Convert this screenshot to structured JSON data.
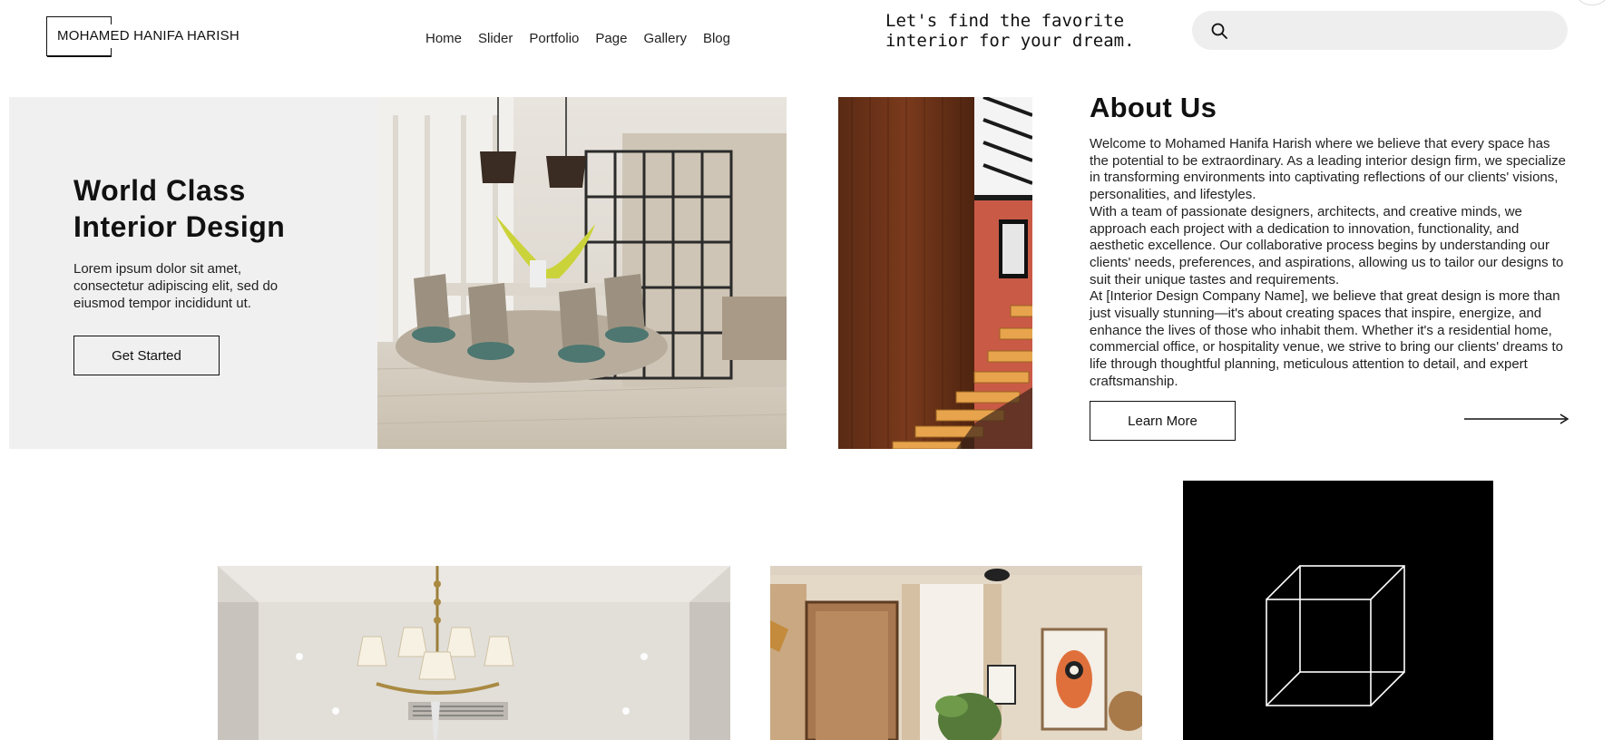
{
  "header": {
    "logo_text": "MOHAMED HANIFA HARISH",
    "nav": [
      "Home",
      "Slider",
      "Portfolio",
      "Page",
      "Gallery",
      "Blog"
    ],
    "tagline": "Let's find the favorite\ninterior for your dream.",
    "search_icon": "search-icon"
  },
  "hero": {
    "title": "World Class\nInterior Design",
    "text": "Lorem ipsum dolor sit amet, consectetur adipiscing elit, sed do eiusmod tempor incididunt ut.",
    "button_label": "Get Started"
  },
  "about": {
    "title": "About Us",
    "paragraphs": [
      "Welcome to Mohamed Hanifa Harish where we believe that every space has the potential to be extraordinary. As a leading interior design firm, we specialize in transforming environments into captivating reflections of our clients' visions, personalities, and lifestyles.",
      "With a team of passionate designers, architects, and creative minds, we approach each project with a dedication to innovation, functionality, and aesthetic excellence. Our collaborative process begins by understanding our clients' needs, preferences, and aspirations, allowing us to tailor our designs to suit their unique tastes and requirements.",
      "At [Interior Design Company Name], we believe that great design is more than just visually stunning—it's about creating spaces that inspire, energize, and enhance the lives of those who inhabit them. Whether it's a residential home, commercial office, or hospitality venue, we strive to bring our clients' dreams to life through thoughtful planning, meticulous attention to detail, and expert craftsmanship."
    ],
    "button_label": "Learn More",
    "arrow_icon": "arrow-right-icon"
  },
  "gallery": {
    "cube_icon": "cube-icon"
  },
  "colors": {
    "hero_bg": "#f0f0f0",
    "search_bg": "#eeeeee",
    "cube_bg": "#000000"
  }
}
